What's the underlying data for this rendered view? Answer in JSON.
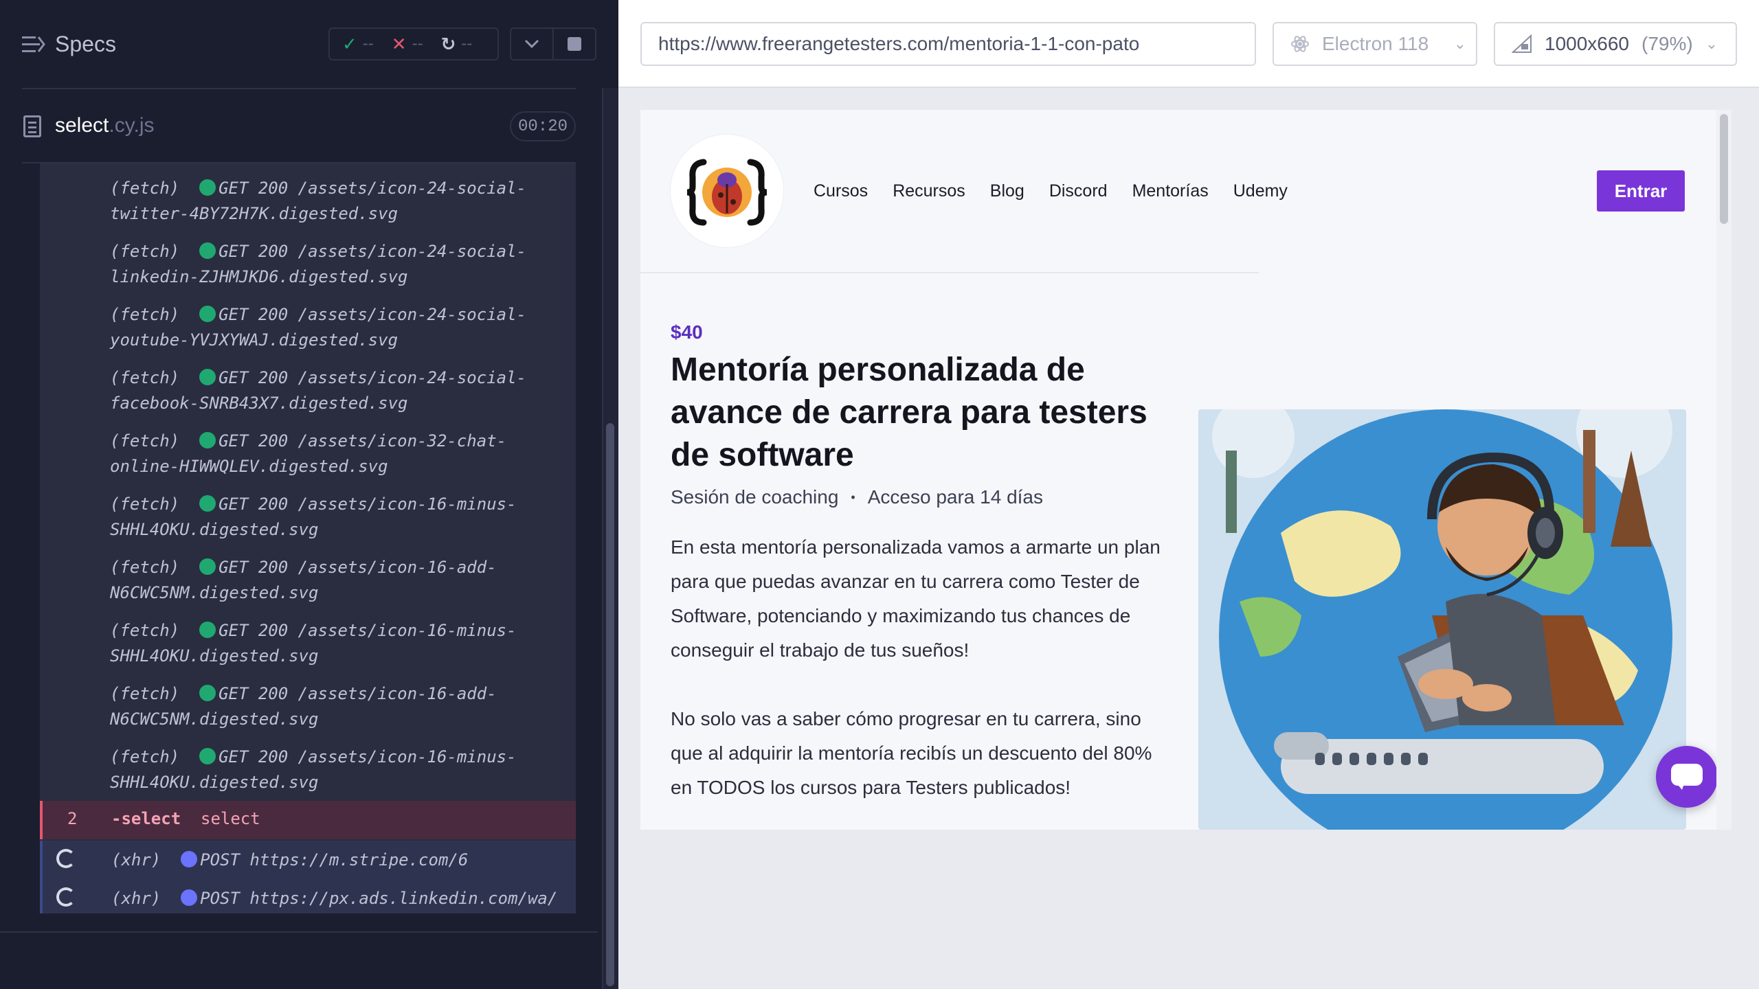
{
  "reporter": {
    "title": "Specs",
    "stats": {
      "passed": "--",
      "failed": "--",
      "pending": "--"
    },
    "spec": {
      "name": "select",
      "ext": ".cy.js",
      "timer": "00:20"
    },
    "log": [
      {
        "type": "(fetch)",
        "line1": "GET 200 /assets/icon-24-social-",
        "line2": "twitter-4BY72H7K.digested.svg"
      },
      {
        "type": "(fetch)",
        "line1": "GET 200 /assets/icon-24-social-",
        "line2": "linkedin-ZJHMJKD6.digested.svg"
      },
      {
        "type": "(fetch)",
        "line1": "GET 200 /assets/icon-24-social-",
        "line2": "youtube-YVJXYWAJ.digested.svg"
      },
      {
        "type": "(fetch)",
        "line1": "GET 200 /assets/icon-24-social-",
        "line2": "facebook-SNRB43X7.digested.svg"
      },
      {
        "type": "(fetch)",
        "line1": "GET 200 /assets/icon-32-chat-",
        "line2": "online-HIWWQLEV.digested.svg"
      },
      {
        "type": "(fetch)",
        "line1": "GET 200 /assets/icon-16-minus-",
        "line2": "SHHL4OKU.digested.svg"
      },
      {
        "type": "(fetch)",
        "line1": "GET 200 /assets/icon-16-add-",
        "line2": "N6CWC5NM.digested.svg"
      },
      {
        "type": "(fetch)",
        "line1": "GET 200 /assets/icon-16-minus-",
        "line2": "SHHL4OKU.digested.svg"
      },
      {
        "type": "(fetch)",
        "line1": "GET 200 /assets/icon-16-add-",
        "line2": "N6CWC5NM.digested.svg"
      },
      {
        "type": "(fetch)",
        "line1": "GET 200 /assets/icon-16-minus-",
        "line2": "SHHL4OKU.digested.svg"
      }
    ],
    "command": {
      "number": "2",
      "name": "-select",
      "message": "select"
    },
    "xhr": [
      {
        "type": "(xhr)",
        "text": "POST https://m.stripe.com/6"
      },
      {
        "type": "(xhr)",
        "text": "POST https://px.ads.linkedin.com/wa/"
      }
    ]
  },
  "browser": {
    "url": "https://www.freerangetesters.com/mentoria-1-1-con-pato",
    "name": "Electron 118",
    "viewport": "1000x660",
    "zoom": "(79%)"
  },
  "site": {
    "nav": [
      "Cursos",
      "Recursos",
      "Blog",
      "Discord",
      "Mentorías",
      "Udemy"
    ],
    "login": "Entrar",
    "price": "$40",
    "title": "Mentoría personalizada de avance de carrera para testers de software",
    "meta1": "Sesión de coaching",
    "meta2": "Acceso para 14 días",
    "para1": "En esta mentoría personalizada vamos a armarte un plan para que puedas avanzar en tu carrera como Tester de Software, potenciando y maximizando tus chances de conseguir el trabajo de tus sueños!",
    "para2": "No solo vas a saber cómo progresar en tu carrera, sino que al adquirir la mentoría recibís un descuento del 80% en TODOS los cursos para Testers publicados!"
  },
  "colors": {
    "accent": "#7a35d8",
    "pass": "#1fa971",
    "fail": "#e45770",
    "request": "#6b73ff"
  }
}
